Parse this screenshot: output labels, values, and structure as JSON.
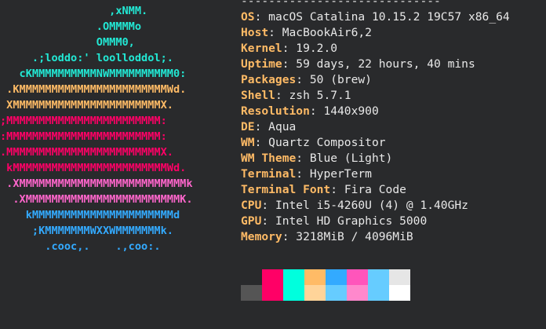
{
  "logo": {
    "lines": [
      {
        "text": "                 ,xNMM.",
        "color": "#22e8d4"
      },
      {
        "text": "               .OMMMMo",
        "color": "#22e8d4"
      },
      {
        "text": "               OMMM0,",
        "color": "#22e8d4"
      },
      {
        "text": "     .;loddo:' loolloddol;.",
        "color": "#22e8d4"
      },
      {
        "text": "   cKMMMMMMMMMMNWMMMMMMMMMM0:",
        "color": "#22e8d4"
      },
      {
        "text": " .KMMMMMMMMMMMMMMMMMMMMMMMWd.",
        "color": "#ffbb66"
      },
      {
        "text": " XMMMMMMMMMMMMMMMMMMMMMMMX.",
        "color": "#ffbb66"
      },
      {
        "text": ";MMMMMMMMMMMMMMMMMMMMMMMM:",
        "color": "#ff0066"
      },
      {
        "text": ":MMMMMMMMMMMMMMMMMMMMMMMM:",
        "color": "#ff0066"
      },
      {
        "text": ".MMMMMMMMMMMMMMMMMMMMMMMMX.",
        "color": "#ff0066"
      },
      {
        "text": " kMMMMMMMMMMMMMMMMMMMMMMMMWd.",
        "color": "#ff0066"
      },
      {
        "text": " .XMMMMMMMMMMMMMMMMMMMMMMMMMMk",
        "color": "#ff66cc"
      },
      {
        "text": "  .XMMMMMMMMMMMMMMMMMMMMMMMMK.",
        "color": "#ff66cc"
      },
      {
        "text": "    kMMMMMMMMMMMMMMMMMMMMMMd",
        "color": "#33aaff"
      },
      {
        "text": "     ;KMMMMMMMWXXWMMMMMMMk.",
        "color": "#33aaff"
      },
      {
        "text": "       .cooc,.    .,coo:.",
        "color": "#33aaff"
      }
    ]
  },
  "info": {
    "separator": "-----------------------------",
    "fields": [
      {
        "key": "OS",
        "value": "macOS Catalina 10.15.2 19C57 x86_64"
      },
      {
        "key": "Host",
        "value": "MacBookAir6,2"
      },
      {
        "key": "Kernel",
        "value": "19.2.0"
      },
      {
        "key": "Uptime",
        "value": "59 days, 22 hours, 40 mins"
      },
      {
        "key": "Packages",
        "value": "50 (brew)"
      },
      {
        "key": "Shell",
        "value": "zsh 5.7.1"
      },
      {
        "key": "Resolution",
        "value": "1440x900"
      },
      {
        "key": "DE",
        "value": "Aqua"
      },
      {
        "key": "WM",
        "value": "Quartz Compositor"
      },
      {
        "key": "WM Theme",
        "value": "Blue (Light)"
      },
      {
        "key": "Terminal",
        "value": "HyperTerm"
      },
      {
        "key": "Terminal Font",
        "value": "Fira Code"
      },
      {
        "key": "CPU",
        "value": "Intel i5-4260U (4) @ 1.40GHz"
      },
      {
        "key": "GPU",
        "value": "Intel HD Graphics 5000"
      },
      {
        "key": "Memory",
        "value": "3218MiB / 4096MiB"
      }
    ]
  },
  "palette": {
    "top": [
      "#292a2c",
      "#ff0066",
      "#00ffdd",
      "#ffbb66",
      "#33aaff",
      "#ff55bb",
      "#66ccff",
      "#e6e6e6"
    ],
    "bottom": [
      "#555555",
      "#ff0066",
      "#00ffdd",
      "#ffd499",
      "#66ccff",
      "#ff88cc",
      "#66ccff",
      "#ffffff"
    ]
  }
}
